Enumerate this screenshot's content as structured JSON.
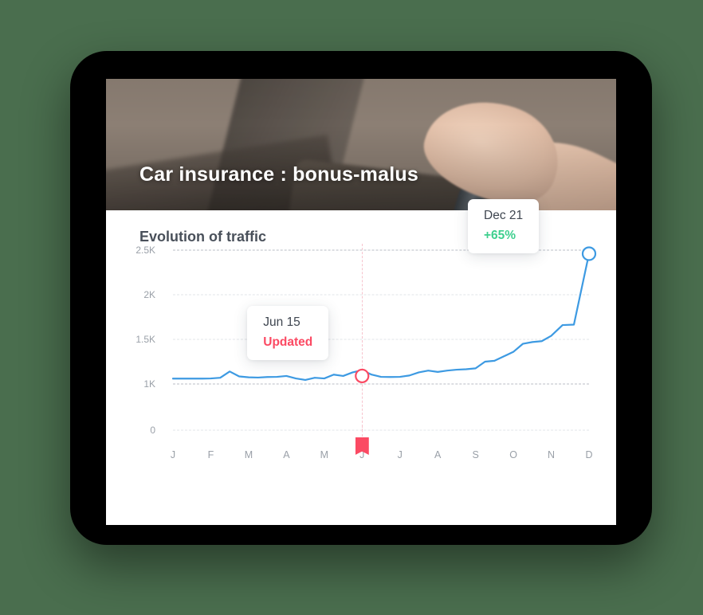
{
  "background_color": "#4a6e4e",
  "device": {
    "name": "tablet-frame",
    "frame_color": "#000000"
  },
  "hero": {
    "title": "Car insurance : bonus-malus",
    "image_alt": "hand on steering wheel car interior"
  },
  "panel": {
    "title": "Evolution of traffic"
  },
  "tooltips": {
    "left": {
      "date": "Jun 15",
      "status": "Updated",
      "status_color": "#fb4a63"
    },
    "right": {
      "date": "Dec 21",
      "delta": "+65%",
      "delta_color": "#3ecf8e"
    }
  },
  "markers": {
    "updated_point_color": "#fb4a63",
    "end_point_color": "#3d9ae2",
    "bookmark_color": "#fb4a63",
    "bookmark_month": "J"
  },
  "chart_data": {
    "type": "line",
    "title": "Evolution of traffic",
    "xlabel": "",
    "ylabel": "",
    "grid": true,
    "legend": null,
    "line_color": "#3d9ae2",
    "categories": [
      "J",
      "F",
      "M",
      "A",
      "M",
      "J",
      "J",
      "A",
      "S",
      "O",
      "N",
      "D"
    ],
    "ytick_labels": [
      "0",
      "1K",
      "1.5K",
      "2K",
      "2.5K"
    ],
    "ytick_values": [
      0,
      1000,
      1500,
      2000,
      2500
    ],
    "ylim": [
      0,
      2500
    ],
    "x": [
      0.0,
      0.25,
      0.5,
      0.75,
      1.0,
      1.25,
      1.5,
      1.75,
      2.0,
      2.25,
      2.5,
      2.75,
      3.0,
      3.25,
      3.5,
      3.75,
      4.0,
      4.25,
      4.5,
      4.75,
      5.0,
      5.25,
      5.5,
      5.75,
      6.0,
      6.25,
      6.5,
      6.75,
      7.0,
      7.25,
      7.5,
      7.75,
      8.0,
      8.25,
      8.5,
      8.75,
      9.0,
      9.25,
      9.5,
      9.75,
      10.0,
      10.3,
      10.6,
      11.0
    ],
    "values": [
      1060,
      1060,
      1060,
      1060,
      1062,
      1070,
      1140,
      1085,
      1075,
      1072,
      1078,
      1080,
      1090,
      1062,
      1045,
      1070,
      1062,
      1105,
      1090,
      1130,
      1155,
      1105,
      1080,
      1078,
      1080,
      1095,
      1130,
      1150,
      1135,
      1150,
      1160,
      1165,
      1175,
      1250,
      1260,
      1310,
      1360,
      1450,
      1470,
      1480,
      1540,
      1660,
      1665,
      2460
    ],
    "annotations": [
      {
        "x": 5.0,
        "y": 1090,
        "label": "Jun 15",
        "sublabel": "Updated",
        "marker": "ring-red"
      },
      {
        "x": 11.0,
        "y": 2460,
        "label": "Dec 21",
        "sublabel": "+65%",
        "marker": "ring-blue"
      }
    ]
  }
}
